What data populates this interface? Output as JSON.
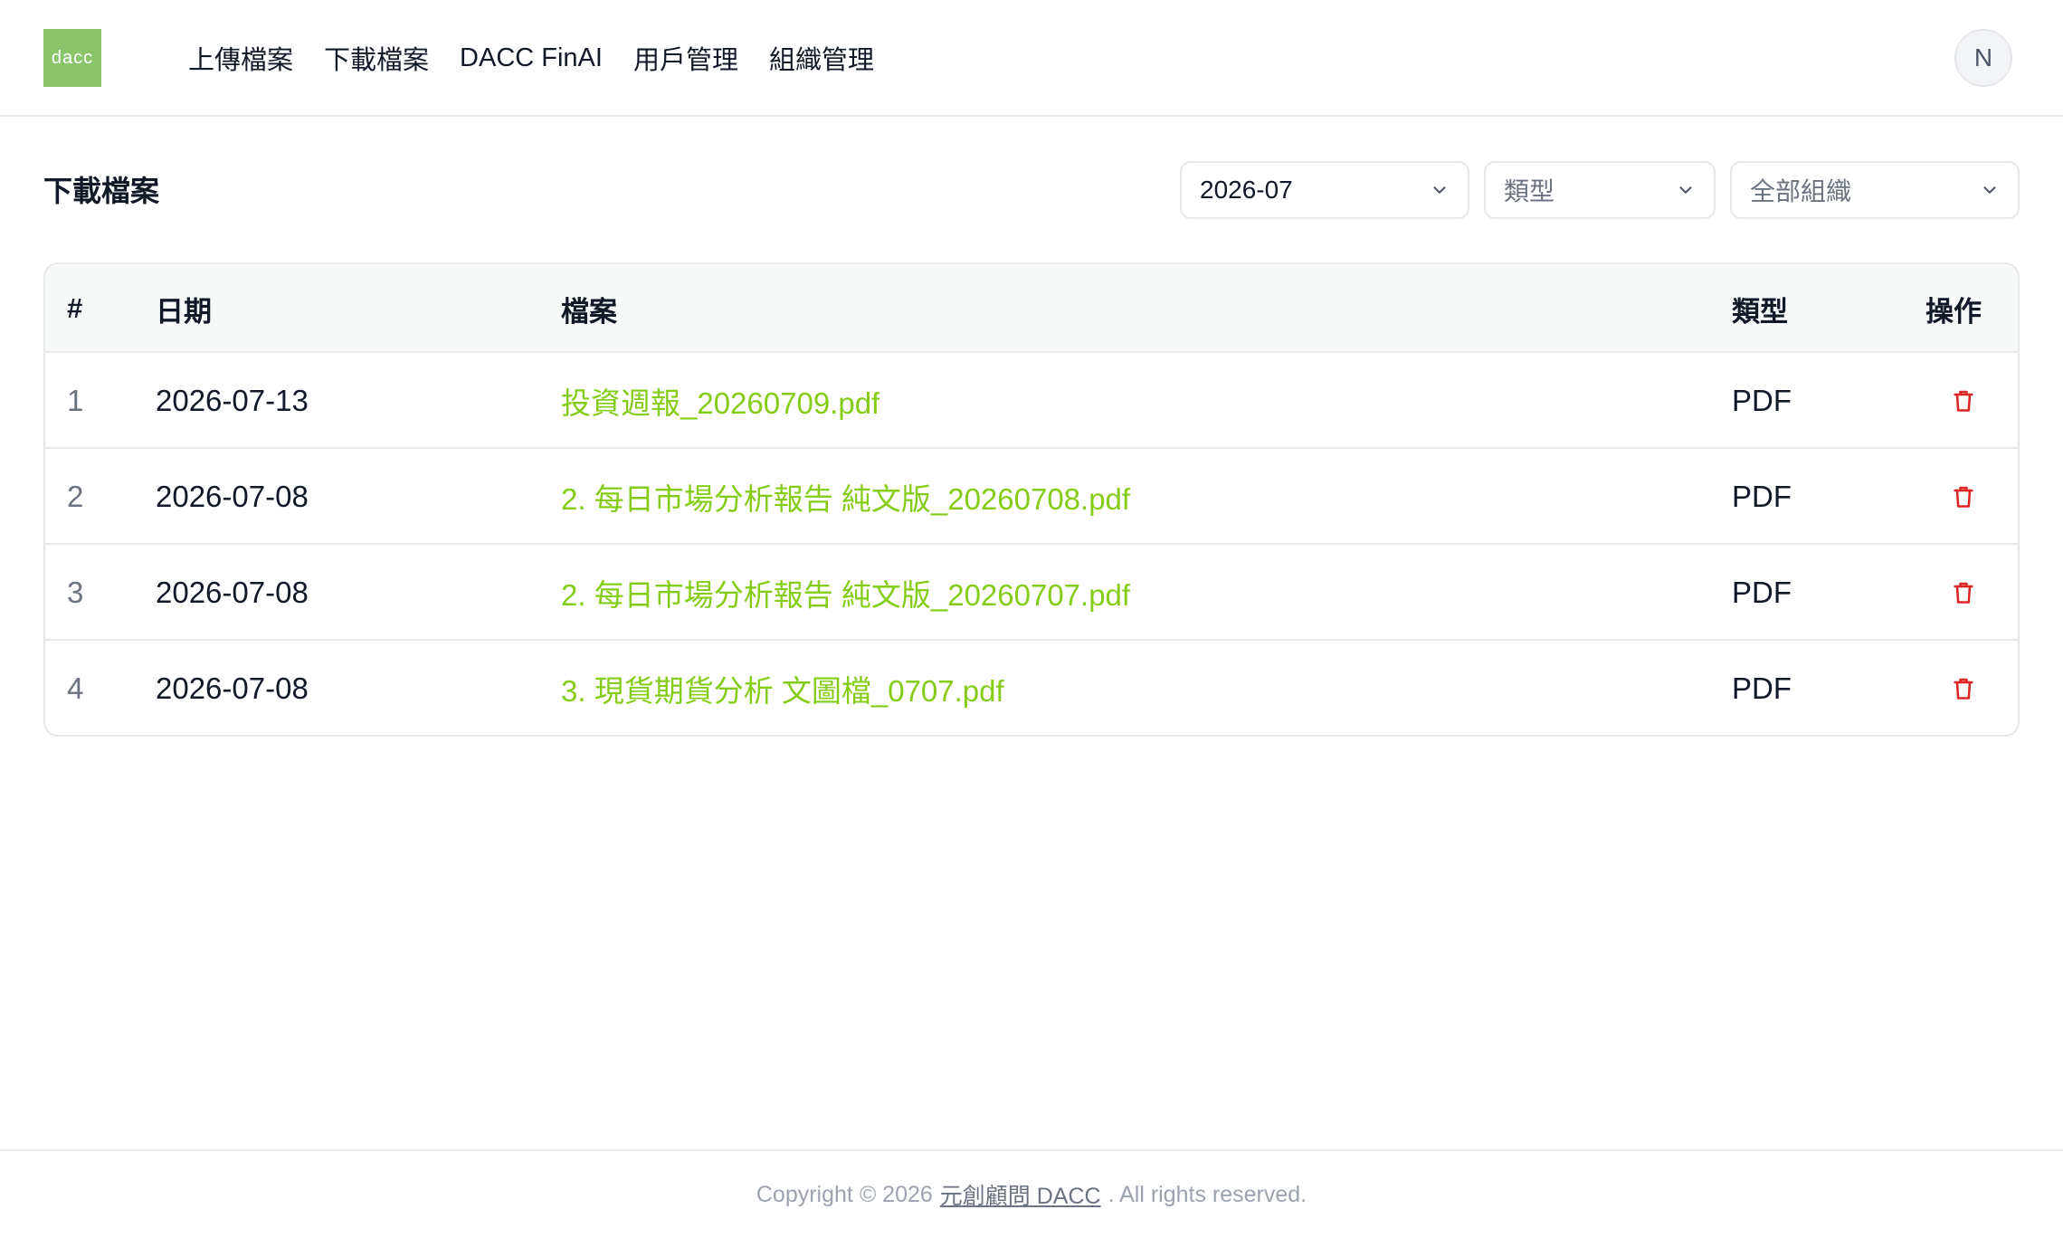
{
  "header": {
    "logo_text": "dacc",
    "nav": [
      {
        "label": "上傳檔案"
      },
      {
        "label": "下載檔案"
      },
      {
        "label": "DACC FinAI"
      },
      {
        "label": "用戶管理"
      },
      {
        "label": "組織管理"
      }
    ],
    "avatar_initial": "N"
  },
  "toolbar": {
    "title": "下載檔案",
    "month_select": {
      "value": "2026-07"
    },
    "type_select": {
      "placeholder": "類型"
    },
    "org_select": {
      "value": "全部組織"
    }
  },
  "table": {
    "columns": {
      "index": "#",
      "date": "日期",
      "file": "檔案",
      "type": "類型",
      "action": "操作"
    },
    "rows": [
      {
        "index": "1",
        "date": "2026-07-13",
        "file": "投資週報_20260709.pdf",
        "type": "PDF",
        "action_icon": "trash-icon"
      },
      {
        "index": "2",
        "date": "2026-07-08",
        "file": "2. 每日市場分析報告 純文版_20260708.pdf",
        "type": "PDF",
        "action_icon": "trash-icon"
      },
      {
        "index": "3",
        "date": "2026-07-08",
        "file": "2. 每日市場分析報告 純文版_20260707.pdf",
        "type": "PDF",
        "action_icon": "trash-icon"
      },
      {
        "index": "4",
        "date": "2026-07-08",
        "file": "3. 現貨期貨分析 文圖檔_0707.pdf",
        "type": "PDF",
        "action_icon": "trash-icon"
      }
    ]
  },
  "footer": {
    "prefix": "Copyright © 2026",
    "link": "元創顧問 DACC",
    "suffix": ". All rights reserved."
  },
  "colors": {
    "brand": "#8bc56b",
    "file_link": "#84cc16",
    "delete": "#dc2626",
    "border": "#e5e7eb"
  }
}
